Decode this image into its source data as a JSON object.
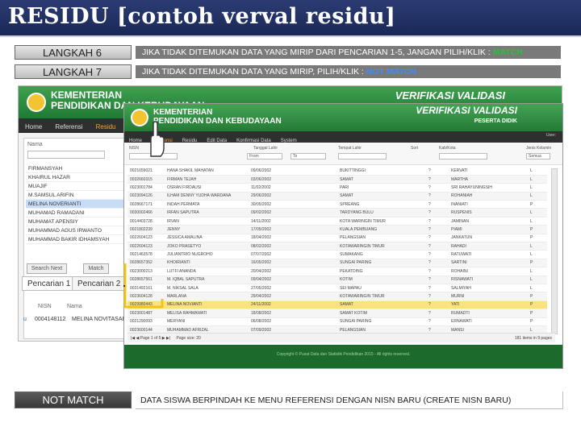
{
  "title": "RESIDU [contoh verval residu]",
  "steps": [
    {
      "label": "LANGKAH 6",
      "desc_prefix": "JIKA TIDAK DITEMUKAN DATA YANG MIRIP DARI PENCARIAN 1-5, JANGAN PILIH/KLIK : ",
      "desc_highlight": "MATCH"
    },
    {
      "label": "LANGKAH 7",
      "desc_prefix": "JIKA TIDAK DITEMUKAN DATA YANG MIRIP, PILIH/KLIK : ",
      "desc_highlight": "NOT MATCH"
    }
  ],
  "back_app": {
    "ministry_line1": "KEMENTERIAN",
    "ministry_line2": "PENDIDIKAN DAN KEBUDAYAAN",
    "verif_title": "VERIFIKASI VALIDASI",
    "nav": [
      "Home",
      "Referensi",
      "Residu"
    ],
    "filter_label": "Nama",
    "names": [
      "FIRMANSYAH",
      "KHAIRUL HAZAR",
      "MUAJIF",
      "M.SAMSUL ARIFIN",
      "MELINA NOVERIANTI",
      "MUHAMAD RAMADANI",
      "MUHAMAT APENSIY",
      "MUHAMMAD AGUS IRWANTO",
      "MUHAMMAD BAKIR IDHAMSYAH"
    ],
    "btn_search": "Search Next",
    "btn_match": "Match",
    "tab1": "Pencarian 1",
    "tab2": "Pencarian 2",
    "col_nisn": "NISN",
    "col_nama": "Nama",
    "row_check": "u",
    "row_nisn": "0004148112",
    "row_name": "MELINA NOVITASARI"
  },
  "front_app": {
    "ministry_line1": "KEMENTERIAN",
    "ministry_line2": "PENDIDIKAN DAN KEBUDAYAAN",
    "verif_title": "VERIFIKASI VALIDASI",
    "verif_sub": "PESERTA DIDIK",
    "nav": [
      "Home",
      "Referensi",
      "Residu",
      "Edit Data",
      "Konfirmasi Data",
      "System"
    ],
    "user": "User:",
    "search_labels": {
      "nisn": "NISN",
      "tgl": "Tanggal Lahir",
      "tempat": "Tempat Lahir",
      "sort": "Sort",
      "kab": "Kab/Kota",
      "jk": "Jenis Kelamin"
    },
    "tgl_from": "From",
    "tgl_to": "To",
    "jk_value": "Semua",
    "rows": [
      [
        "0021659021",
        "HANA SHAKIL MAHATAN",
        "09/06/2002",
        "BUKITTINGGI",
        "?",
        "KERVATI",
        "L"
      ],
      [
        "0032660315",
        "FIRMAN TEJAH",
        "03/06/2002",
        "SAMAT",
        "?",
        "MARTHA",
        "L"
      ],
      [
        "0023001784",
        "OSRAN FIRDAUSI",
        "11/02/2002",
        "PARI",
        "?",
        "SRI RAHAYUNINGSIH",
        "L"
      ],
      [
        "0023094126",
        "ILHAM DENNY YUDHA WARDANA",
        "29/06/2002",
        "SAMAT",
        "?",
        "ROHANIAH",
        "L"
      ],
      [
        "0028667171",
        "INDAH PERMATA",
        "30/05/2002",
        "SPREANG",
        "?",
        "INANIATI",
        "P"
      ],
      [
        "0030002466",
        "IRFAN SAPUTRA",
        "09/02/2002",
        "TARDYANG BULU",
        "?",
        "RUSPENIS",
        "L"
      ],
      [
        "0014403728",
        "IRVAN",
        "14/11/2002",
        "KOTA WARINGIN TIMUR",
        "?",
        "JAMINAN",
        "L"
      ],
      [
        "0021802239",
        "JENNY",
        "17/05/2002",
        "KUALA PEMBUANG",
        "?",
        "PIAMI",
        "P"
      ],
      [
        "0022604123",
        "JESSICA AMALINA",
        "18/04/2002",
        "PELANGSIAN",
        "?",
        "JANKATUN",
        "P"
      ],
      [
        "0022604123",
        "JOKO PRASETYO",
        "08/02/2002",
        "KOTAWARINGIN TIMUR",
        "?",
        "RAHADI",
        "L"
      ],
      [
        "0021463578",
        "JULIANTRIO NUGROHO",
        "07/07/2002",
        "SUMAKANG",
        "?",
        "RATUWATI",
        "L"
      ],
      [
        "0028657352",
        "KHOIRIANTI",
        "16/05/2002",
        "SUNGAI PARING",
        "?",
        "SARTINI",
        "P"
      ],
      [
        "0023000213",
        "LUTFI ANANDA",
        "20/04/2002",
        "PEKATDING",
        "?",
        "ROHAINI",
        "L"
      ],
      [
        "0028657561",
        "M. IQBAL SAPUTRA",
        "09/04/2002",
        "KOTIM",
        "?",
        "RISNAWATI",
        "L"
      ],
      [
        "0031492161",
        "M. NIKSAL SALA",
        "27/05/2002",
        "SEI MAPAU",
        "?",
        "SALMIYAH",
        "L"
      ],
      [
        "0023604128",
        "MARLANA",
        "29/04/2002",
        "KOTAWARINGIN TIMUR",
        "?",
        "MURNI",
        "P"
      ],
      [
        "0029980443",
        "MELINA NOVIANTI",
        "24/11/2002",
        "SAMAT",
        "?",
        "YATI",
        "P"
      ],
      [
        "0023001487",
        "MELISA RAHMAWATI",
        "18/08/2002",
        "SAMAT KOTIM",
        "?",
        "RUMADTI",
        "P"
      ],
      [
        "0021290093",
        "MERYANI",
        "06/08/2002",
        "SUNGAI PARING",
        "?",
        "ERNAWATI",
        "P"
      ],
      [
        "0023600144",
        "MUHAMMAD AFRIZAL",
        "07/09/2002",
        "PELANGSIAN",
        "?",
        "MANSI",
        "L"
      ]
    ],
    "pager_nav": "|◀ ◀  Page 1 of 5  ▶ ▶|",
    "pager_size_label": "Page size:",
    "pager_size": "20",
    "pager_info": "181 items in 9 pages",
    "footer": "Copyright © Pusat Data dan Statistik Pendidikan 2015 - All rights reserved."
  },
  "not_match": {
    "label": "NOT MATCH",
    "desc": "DATA SISWA BERPINDAH KE MENU REFERENSI DENGAN NISN BARU (CREATE NISN BARU)"
  },
  "colors": {
    "banner": "#22336a",
    "green_header": "#2f8c41",
    "highlight_row": "#fbe27d",
    "match": "#27c23b",
    "not_match": "#3f8cff"
  }
}
